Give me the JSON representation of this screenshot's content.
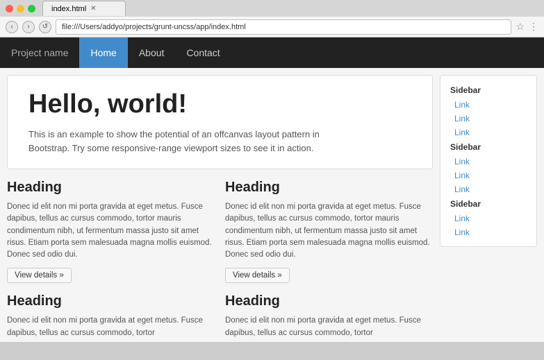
{
  "browser": {
    "tab_title": "index.html",
    "url": "file:///Users/addyo/projects/grunt-uncss/app/index.html",
    "nav_back": "‹",
    "nav_forward": "›",
    "nav_reload": "↺"
  },
  "nav": {
    "brand": "Project name",
    "links": [
      {
        "label": "Home",
        "active": true
      },
      {
        "label": "About",
        "active": false
      },
      {
        "label": "Contact",
        "active": false
      }
    ]
  },
  "jumbotron": {
    "heading": "Hello, world!",
    "body": "This is an example to show the potential of an offcanvas layout pattern in Bootstrap. Try some responsive-range viewport sizes to see it in action."
  },
  "columns": [
    {
      "heading": "Heading",
      "body": "Donec id elit non mi porta gravida at eget metus. Fusce dapibus, tellus ac cursus commodo, tortor mauris condimentum nibh, ut fermentum massa justo sit amet risus. Etiam porta sem malesuada magna mollis euismod. Donec sed odio dui.",
      "button": "View details »"
    },
    {
      "heading": "Heading",
      "body": "Donec id elit non mi porta gravida at eget metus. Fusce dapibus, tellus ac cursus commodo, tortor mauris condimentum nibh, ut fermentum massa justo sit amet risus. Etiam porta sem malesuada magna mollis euismod. Donec sed odio dui.",
      "button": "View details »"
    },
    {
      "heading": "Heading",
      "body": "Donec id elit non mi porta gravida at eget metus. Fusce dapibus, tellus ac cursus commodo, tortor",
      "button": ""
    },
    {
      "heading": "Heading",
      "body": "Donec id elit non mi porta gravida at eget metus. Fusce dapibus, tellus ac cursus commodo, tortor",
      "button": ""
    }
  ],
  "sidebar": {
    "sections": [
      {
        "heading": "Sidebar",
        "links": [
          "Link",
          "Link",
          "Link"
        ]
      },
      {
        "heading": "Sidebar",
        "links": [
          "Link",
          "Link",
          "Link"
        ]
      },
      {
        "heading": "Sidebar",
        "links": [
          "Link",
          "Link"
        ]
      }
    ]
  }
}
